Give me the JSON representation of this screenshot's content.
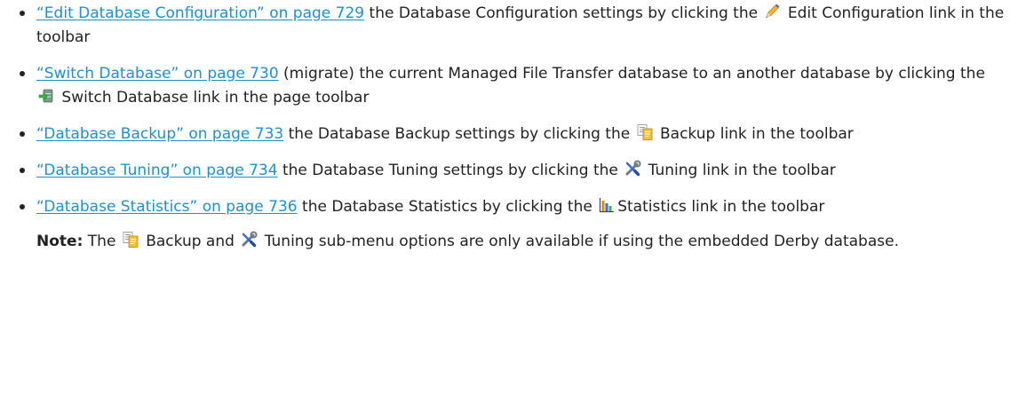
{
  "items": [
    {
      "link": "“Edit Database Configuration” on page 729",
      "before": " the Database Configuration settings by clicking the ",
      "icon": "pencil-icon",
      "after": " Edit Configuration link in the toolbar"
    },
    {
      "link": "“Switch Database” on page 730",
      "before": " (migrate) the current Managed File Transfer database to an another database by clicking the ",
      "icon": "switch-database-icon",
      "after": " Switch Database link in the page toolbar"
    },
    {
      "link": "“Database Backup” on page 733",
      "before": " the Database Backup settings by clicking the ",
      "icon": "backup-icon",
      "after": " Backup link in the toolbar"
    },
    {
      "link": "“Database Tuning” on page 734",
      "before": " the Database Tuning settings by clicking the ",
      "icon": "tools-icon",
      "after": " Tuning link in the toolbar"
    },
    {
      "link": "“Database Statistics” on page 736",
      "before": " the Database Statistics by clicking the ",
      "icon": "statistics-icon",
      "after": "Statistics link in the toolbar"
    }
  ],
  "note": {
    "label": "Note:",
    "part1": " The ",
    "icon1": "backup-icon",
    "part2": " Backup and ",
    "icon2": "tools-icon",
    "part3": " Tuning sub-menu options are only available if using the embedded Derby database."
  },
  "colors": {
    "link": "#1f8fce",
    "text": "#222222"
  }
}
